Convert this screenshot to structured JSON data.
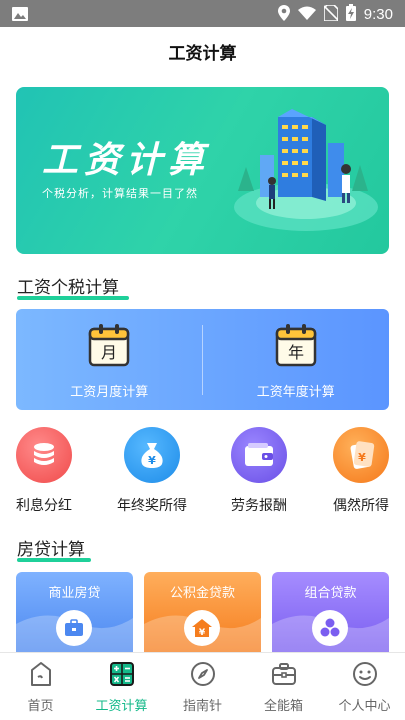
{
  "status_bar": {
    "time": "9:30",
    "icons": [
      "image-icon",
      "location-icon",
      "wifi-icon",
      "no-sim-icon",
      "battery-charging-icon"
    ]
  },
  "header": {
    "title": "工资计算"
  },
  "banner": {
    "title": "工资计算",
    "subtitle": "个税分析，计算结果一目了然",
    "colors": {
      "start": "#21c3b4",
      "end": "#23c89e"
    }
  },
  "salary_section": {
    "title": "工资个税计算",
    "items": [
      {
        "label": "工资月度计算",
        "icon_text": "月",
        "icon": "calendar-icon"
      },
      {
        "label": "工资年度计算",
        "icon_text": "年",
        "icon": "calendar-icon"
      }
    ]
  },
  "tools": [
    {
      "label": "利息分红",
      "icon": "coin-stack-icon",
      "color": "#f55f5f"
    },
    {
      "label": "年终奖所得",
      "icon": "money-bag-icon",
      "color": "#2c9cf0"
    },
    {
      "label": "劳务报酬",
      "icon": "wallet-icon",
      "color": "#7a62ee"
    },
    {
      "label": "偶然所得",
      "icon": "lucky-bag-icon",
      "color": "#f98a2a"
    }
  ],
  "loan_section": {
    "title": "房贷计算",
    "items": [
      {
        "label": "商业房贷",
        "icon": "briefcase-icon",
        "color": "#5a96f5"
      },
      {
        "label": "公积金贷款",
        "icon": "house-yen-icon",
        "color": "#f98a2a"
      },
      {
        "label": "组合贷款",
        "icon": "hexagon-combo-icon",
        "color": "#8a6af2"
      }
    ]
  },
  "bottom_nav": {
    "active_color": "#14b98a",
    "items": [
      {
        "label": "首页",
        "icon": "home-icon"
      },
      {
        "label": "工资计算",
        "icon": "calculator-icon",
        "active": true
      },
      {
        "label": "指南针",
        "icon": "compass-icon"
      },
      {
        "label": "全能箱",
        "icon": "toolbox-icon"
      },
      {
        "label": "个人中心",
        "icon": "smile-icon"
      }
    ]
  }
}
